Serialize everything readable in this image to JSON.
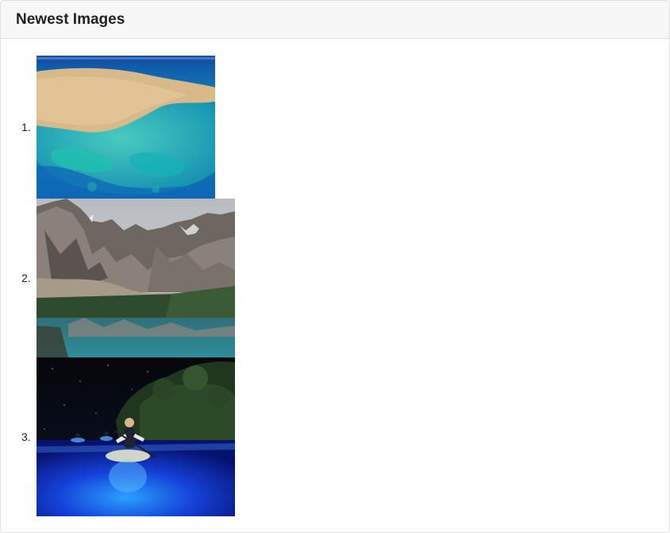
{
  "card": {
    "title": "Newest Images"
  },
  "images": [
    {
      "number": "1.",
      "subject": "aerial view of coral reef in turquoise sea",
      "icon": "reef-aerial-image"
    },
    {
      "number": "2.",
      "subject": "rocky mountain peaks reflected in turquoise lake",
      "icon": "mountain-lake-image"
    },
    {
      "number": "3.",
      "subject": "night kayaking on glowing blue bioluminescent water",
      "icon": "night-kayak-image"
    }
  ]
}
